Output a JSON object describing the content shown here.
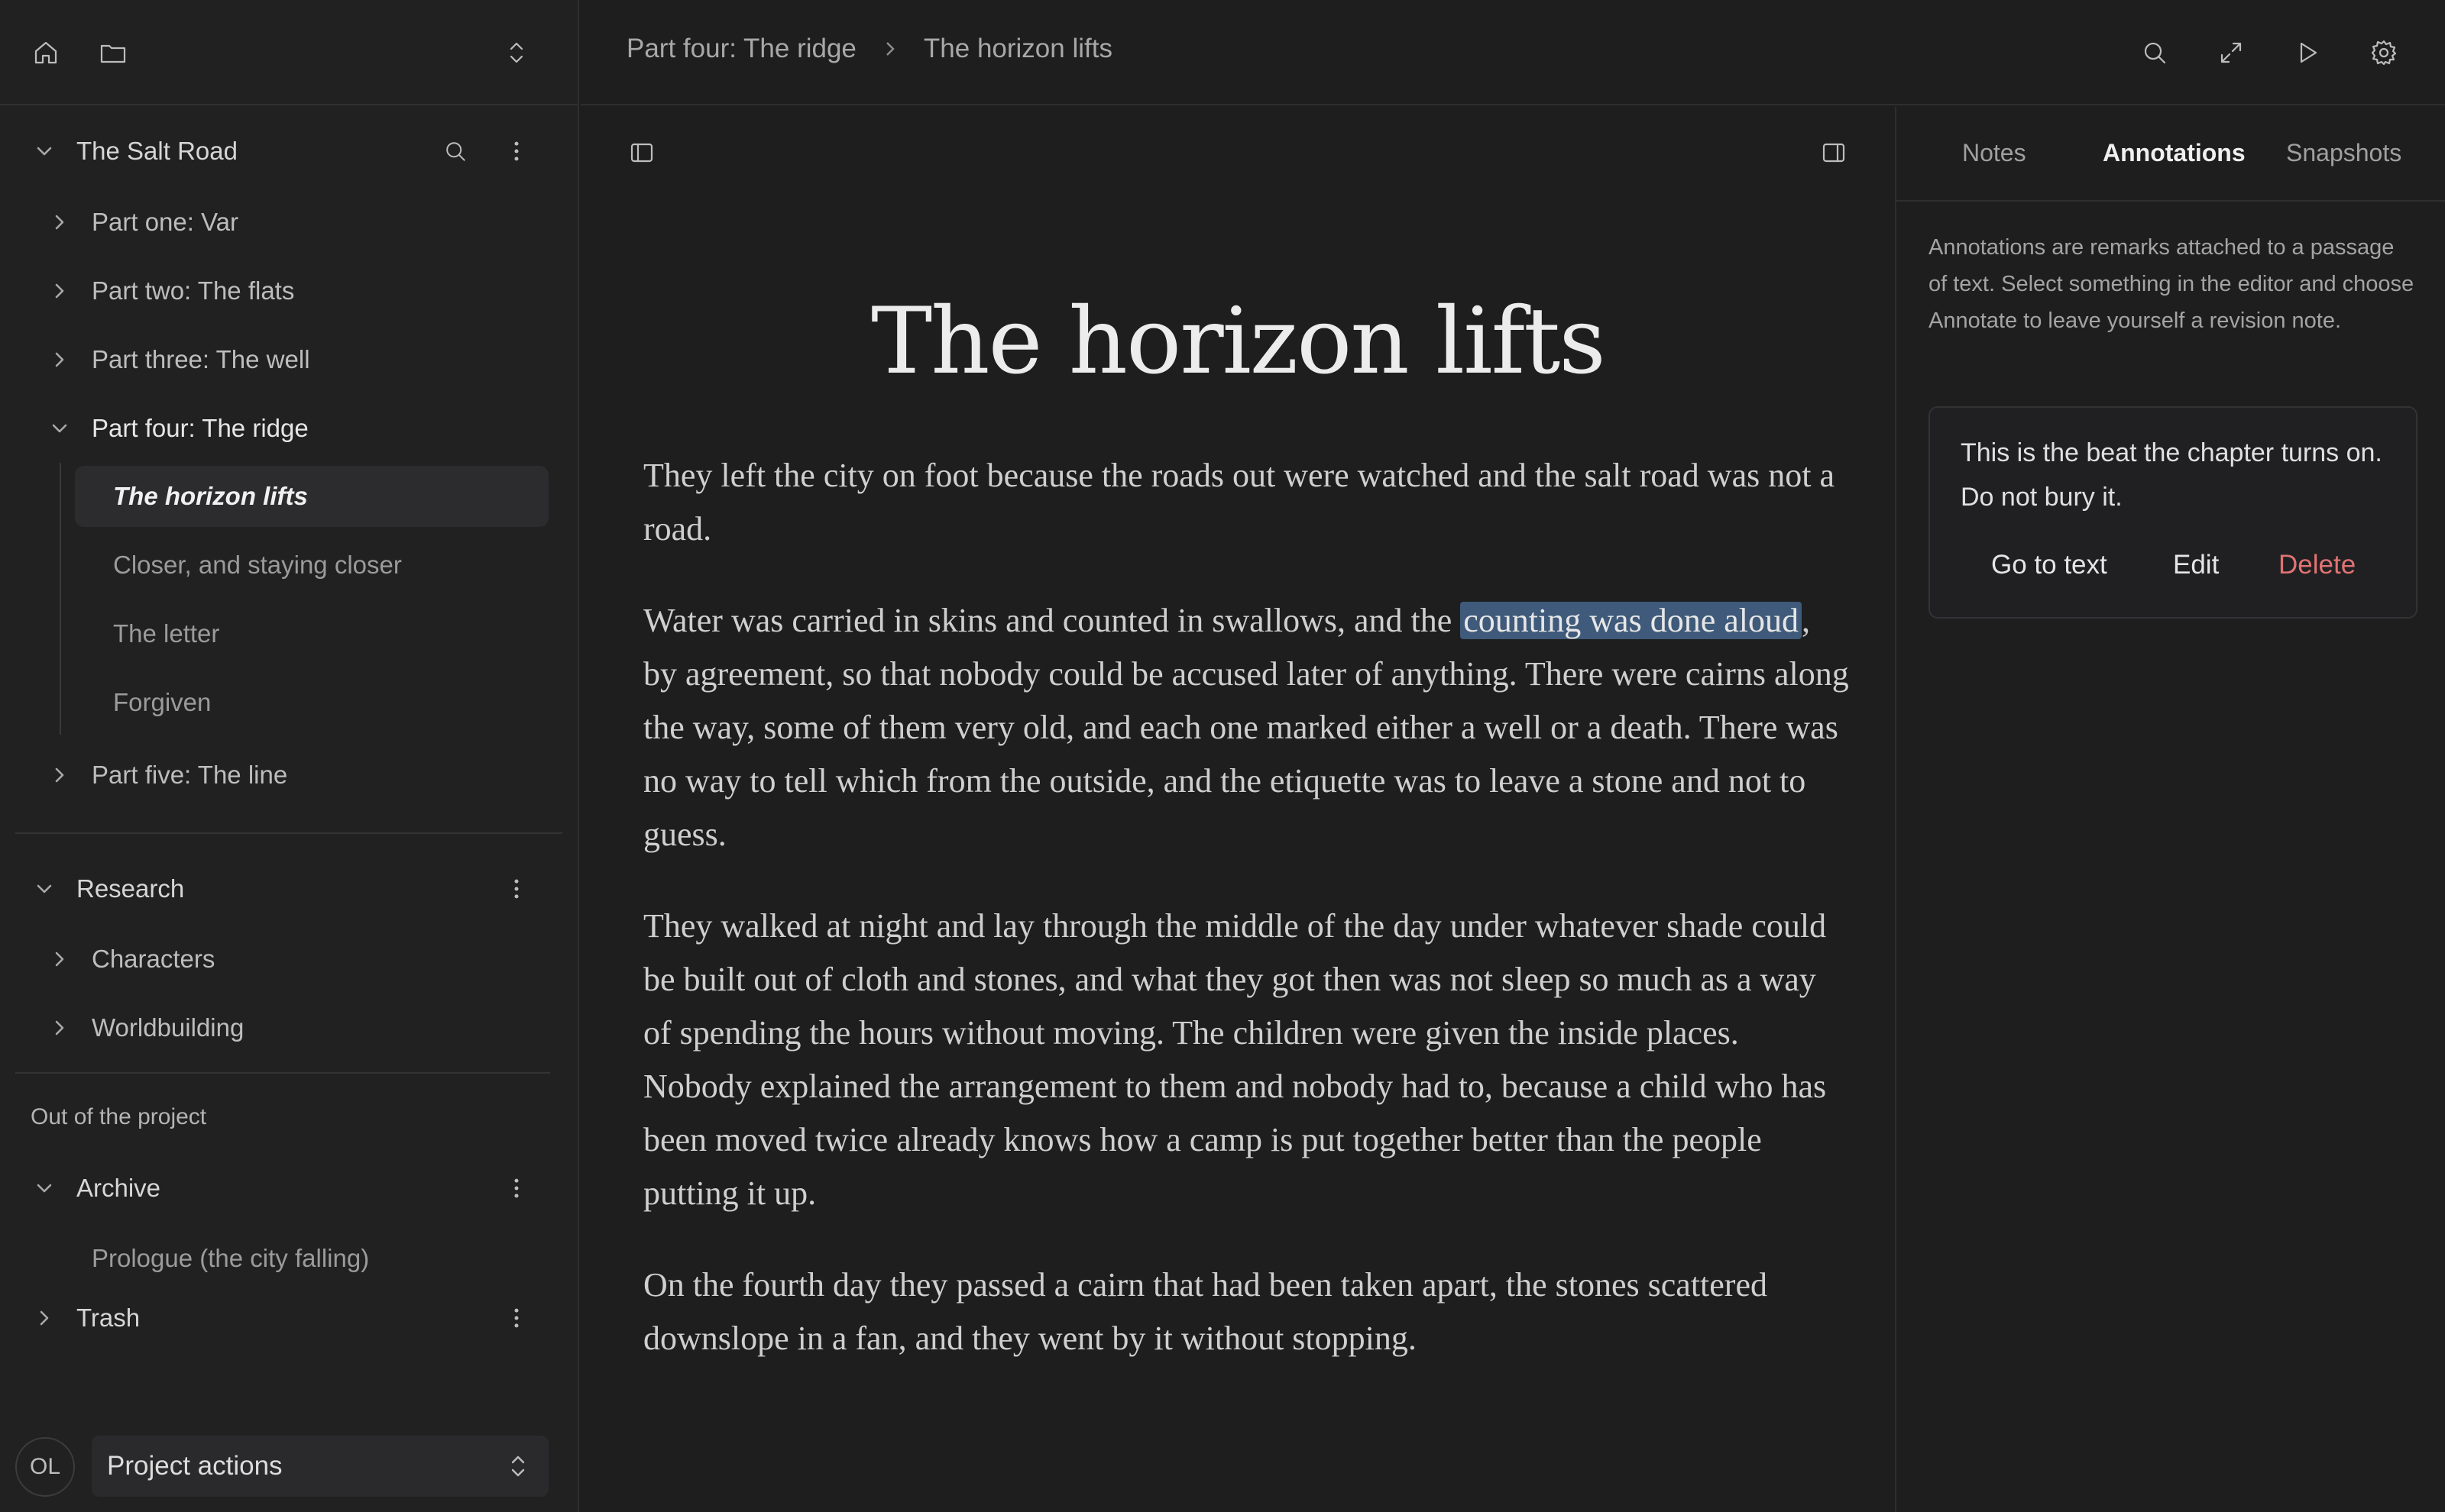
{
  "topbar": {
    "breadcrumb": [
      "Part four: The ridge",
      "The horizon lifts"
    ],
    "icons": [
      "search-icon",
      "expand-icon",
      "play-icon",
      "gear-icon"
    ]
  },
  "sidebar": {
    "top_icons": [
      "home-icon",
      "folder-icon",
      "chevron-updown-icon"
    ],
    "project": {
      "title": "The Salt Road",
      "parts": [
        {
          "label": "Part one: Var"
        },
        {
          "label": "Part two: The flats"
        },
        {
          "label": "Part three: The well"
        },
        {
          "label": "Part four: The ridge",
          "scenes": [
            "The horizon lifts",
            "Closer, and staying closer",
            "The letter",
            "Forgiven"
          ],
          "active_scene": "The horizon lifts"
        },
        {
          "label": "Part five: The line"
        }
      ]
    },
    "research": {
      "title": "Research",
      "items": [
        "Characters",
        "Worldbuilding"
      ]
    },
    "outside": {
      "label": "Out of the project",
      "archive": {
        "title": "Archive",
        "items": [
          "Prologue (the city falling)"
        ]
      },
      "trash": {
        "title": "Trash"
      }
    },
    "footer": {
      "avatar": "OL",
      "actions_label": "Project actions"
    }
  },
  "editor": {
    "toggle_icons": [
      "left-sidebar-icon",
      "right-sidebar-icon"
    ],
    "title": "The horizon lifts",
    "paragraphs": [
      {
        "text": "They left the city on foot because the roads out were watched and the salt road was not a road."
      },
      {
        "before": "Water was carried in skins and counted in swallows, and the ",
        "highlight": "counting was done aloud",
        "after": ", by agreement, so that nobody could be accused later of anything. There were cairns along the way, some of them very old, and each one marked either a well or a death. There was no way to tell which from the outside, and the etiquette was to leave a stone and not to guess."
      },
      {
        "text": "They walked at night and lay through the middle of the day under whatever shade could be built out of cloth and stones, and what they got then was not sleep so much as a way of spending the hours without moving. The children were given the inside places. Nobody explained the arrangement to them and nobody had to, because a child who has been moved twice already knows how a camp is put together better than the people putting it up."
      },
      {
        "text": "On the fourth day they passed a cairn that had been taken apart, the stones scattered downslope in a fan, and they went by it without stopping."
      }
    ]
  },
  "right_panel": {
    "tabs": [
      "Notes",
      "Annotations",
      "Snapshots"
    ],
    "selected_tab": "Annotations",
    "info": "Annotations are remarks attached to a passage of text. Select something in the editor and choose Annotate to leave yourself a revision note.",
    "annotation": {
      "text": "This is the beat the chapter turns on. Do not bury it.",
      "actions": {
        "goto": "Go to text",
        "edit": "Edit",
        "delete": "Delete"
      },
      "delete_color": "#e07373"
    }
  },
  "colors": {
    "highlight": "#3f5a7a",
    "background": "#1e1e1f",
    "sidebar": "#212122"
  }
}
